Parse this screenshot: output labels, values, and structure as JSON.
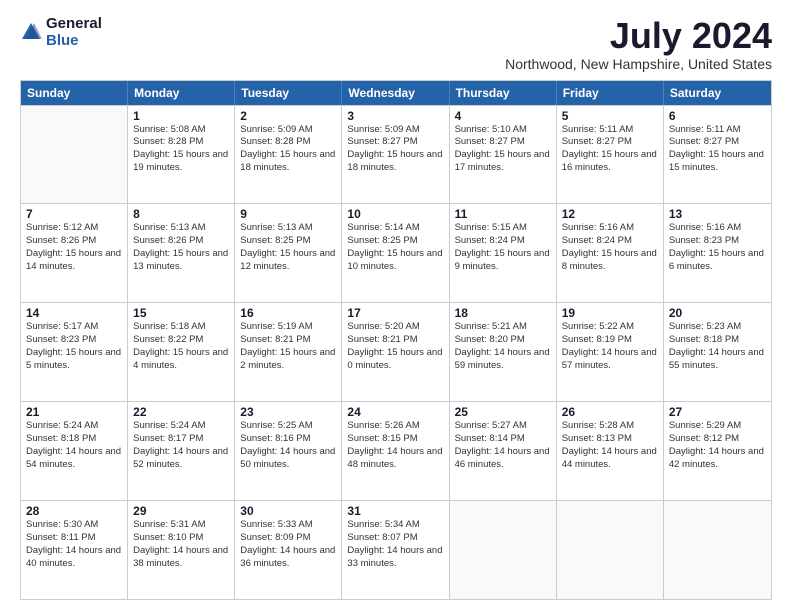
{
  "logo": {
    "general": "General",
    "blue": "Blue"
  },
  "title": "July 2024",
  "location": "Northwood, New Hampshire, United States",
  "header_days": [
    "Sunday",
    "Monday",
    "Tuesday",
    "Wednesday",
    "Thursday",
    "Friday",
    "Saturday"
  ],
  "rows": [
    [
      {
        "day": "",
        "empty": true
      },
      {
        "day": "1",
        "rise": "5:08 AM",
        "set": "8:28 PM",
        "daylight": "15 hours and 19 minutes."
      },
      {
        "day": "2",
        "rise": "5:09 AM",
        "set": "8:28 PM",
        "daylight": "15 hours and 18 minutes."
      },
      {
        "day": "3",
        "rise": "5:09 AM",
        "set": "8:27 PM",
        "daylight": "15 hours and 18 minutes."
      },
      {
        "day": "4",
        "rise": "5:10 AM",
        "set": "8:27 PM",
        "daylight": "15 hours and 17 minutes."
      },
      {
        "day": "5",
        "rise": "5:11 AM",
        "set": "8:27 PM",
        "daylight": "15 hours and 16 minutes."
      },
      {
        "day": "6",
        "rise": "5:11 AM",
        "set": "8:27 PM",
        "daylight": "15 hours and 15 minutes."
      }
    ],
    [
      {
        "day": "7",
        "rise": "5:12 AM",
        "set": "8:26 PM",
        "daylight": "15 hours and 14 minutes."
      },
      {
        "day": "8",
        "rise": "5:13 AM",
        "set": "8:26 PM",
        "daylight": "15 hours and 13 minutes."
      },
      {
        "day": "9",
        "rise": "5:13 AM",
        "set": "8:25 PM",
        "daylight": "15 hours and 12 minutes."
      },
      {
        "day": "10",
        "rise": "5:14 AM",
        "set": "8:25 PM",
        "daylight": "15 hours and 10 minutes."
      },
      {
        "day": "11",
        "rise": "5:15 AM",
        "set": "8:24 PM",
        "daylight": "15 hours and 9 minutes."
      },
      {
        "day": "12",
        "rise": "5:16 AM",
        "set": "8:24 PM",
        "daylight": "15 hours and 8 minutes."
      },
      {
        "day": "13",
        "rise": "5:16 AM",
        "set": "8:23 PM",
        "daylight": "15 hours and 6 minutes."
      }
    ],
    [
      {
        "day": "14",
        "rise": "5:17 AM",
        "set": "8:23 PM",
        "daylight": "15 hours and 5 minutes."
      },
      {
        "day": "15",
        "rise": "5:18 AM",
        "set": "8:22 PM",
        "daylight": "15 hours and 4 minutes."
      },
      {
        "day": "16",
        "rise": "5:19 AM",
        "set": "8:21 PM",
        "daylight": "15 hours and 2 minutes."
      },
      {
        "day": "17",
        "rise": "5:20 AM",
        "set": "8:21 PM",
        "daylight": "15 hours and 0 minutes."
      },
      {
        "day": "18",
        "rise": "5:21 AM",
        "set": "8:20 PM",
        "daylight": "14 hours and 59 minutes."
      },
      {
        "day": "19",
        "rise": "5:22 AM",
        "set": "8:19 PM",
        "daylight": "14 hours and 57 minutes."
      },
      {
        "day": "20",
        "rise": "5:23 AM",
        "set": "8:18 PM",
        "daylight": "14 hours and 55 minutes."
      }
    ],
    [
      {
        "day": "21",
        "rise": "5:24 AM",
        "set": "8:18 PM",
        "daylight": "14 hours and 54 minutes."
      },
      {
        "day": "22",
        "rise": "5:24 AM",
        "set": "8:17 PM",
        "daylight": "14 hours and 52 minutes."
      },
      {
        "day": "23",
        "rise": "5:25 AM",
        "set": "8:16 PM",
        "daylight": "14 hours and 50 minutes."
      },
      {
        "day": "24",
        "rise": "5:26 AM",
        "set": "8:15 PM",
        "daylight": "14 hours and 48 minutes."
      },
      {
        "day": "25",
        "rise": "5:27 AM",
        "set": "8:14 PM",
        "daylight": "14 hours and 46 minutes."
      },
      {
        "day": "26",
        "rise": "5:28 AM",
        "set": "8:13 PM",
        "daylight": "14 hours and 44 minutes."
      },
      {
        "day": "27",
        "rise": "5:29 AM",
        "set": "8:12 PM",
        "daylight": "14 hours and 42 minutes."
      }
    ],
    [
      {
        "day": "28",
        "rise": "5:30 AM",
        "set": "8:11 PM",
        "daylight": "14 hours and 40 minutes."
      },
      {
        "day": "29",
        "rise": "5:31 AM",
        "set": "8:10 PM",
        "daylight": "14 hours and 38 minutes."
      },
      {
        "day": "30",
        "rise": "5:33 AM",
        "set": "8:09 PM",
        "daylight": "14 hours and 36 minutes."
      },
      {
        "day": "31",
        "rise": "5:34 AM",
        "set": "8:07 PM",
        "daylight": "14 hours and 33 minutes."
      },
      {
        "day": "",
        "empty": true
      },
      {
        "day": "",
        "empty": true
      },
      {
        "day": "",
        "empty": true
      }
    ]
  ]
}
